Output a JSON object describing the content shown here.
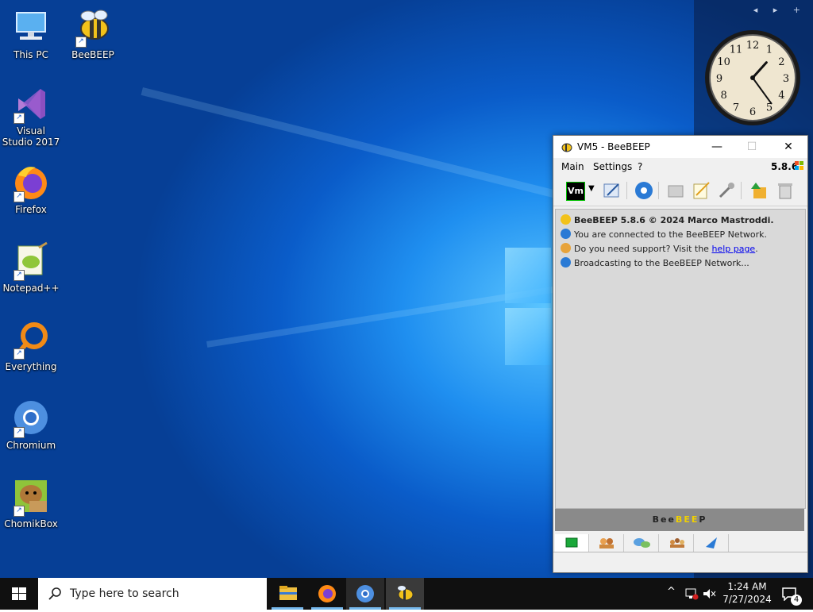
{
  "desktop_icons": [
    {
      "label": "This PC",
      "icon": "computer-icon"
    },
    {
      "label": "BeeBEEP",
      "icon": "bee-icon"
    },
    {
      "label": "Visual Studio 2017",
      "icon": "visual-studio-icon"
    },
    {
      "label": "Firefox",
      "icon": "firefox-icon"
    },
    {
      "label": "Notepad++",
      "icon": "notepadpp-icon"
    },
    {
      "label": "Everything",
      "icon": "search-magnifier-icon"
    },
    {
      "label": "Chromium",
      "icon": "chromium-icon"
    },
    {
      "label": "ChomikBox",
      "icon": "hamster-box-icon"
    }
  ],
  "clock": {
    "numbers": [
      "12",
      "1",
      "2",
      "3",
      "4",
      "5",
      "6",
      "7",
      "8",
      "9",
      "10",
      "11"
    ],
    "hour": 1,
    "minute": 24
  },
  "app": {
    "title": "VM5 - BeeBEEP",
    "version": "5.8.6",
    "menu": [
      "Main",
      "Settings",
      "?"
    ],
    "status_badge": "Vm",
    "messages": {
      "line1": "BeeBEEP 5.8.6 © 2024 Marco Mastroddi.",
      "line2": "You are connected to the BeeBEEP Network.",
      "line3_prefix": "Do you need support? Visit the ",
      "line3_link": "help page",
      "line3_suffix": ".",
      "line4": "Broadcasting to the BeeBEEP Network..."
    },
    "banner_letters": [
      "B",
      "e",
      "e",
      "B",
      "E",
      "E",
      "P"
    ],
    "banner_colors": [
      "#222222",
      "#222222",
      "#222222",
      "#f0d000",
      "#f0d000",
      "#f0d000",
      "#222222"
    ]
  },
  "taskbar": {
    "search_placeholder": "Type here to search",
    "time": "1:24 AM",
    "date": "7/27/2024",
    "notification_count": "4"
  },
  "colors": {
    "accent": "#0078d7",
    "link": "#0000ee"
  }
}
